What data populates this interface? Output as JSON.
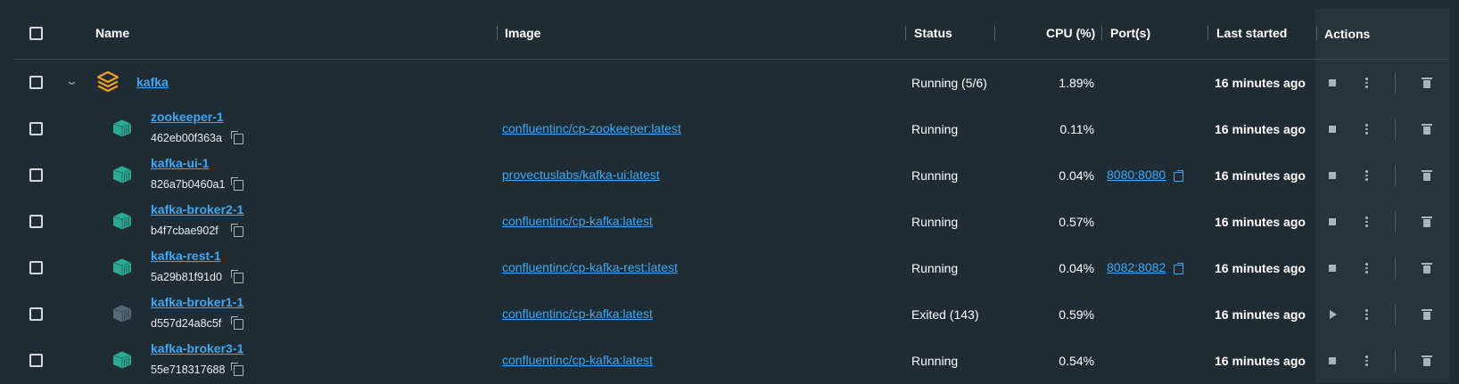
{
  "header": {
    "name": "Name",
    "image": "Image",
    "status": "Status",
    "cpu": "CPU (%)",
    "ports": "Port(s)",
    "last_started": "Last started",
    "actions": "Actions"
  },
  "stack": {
    "name": "kafka",
    "status": "Running (5/6)",
    "cpu": "1.89%",
    "last_started": "16 minutes ago",
    "icon": "stack-layers-icon",
    "icon_color": "#f0a020"
  },
  "containers": [
    {
      "name": "zookeeper-1",
      "id": "462eb00f363a",
      "image": "confluentinc/cp-zookeeper:latest",
      "status": "Running",
      "cpu": "0.11%",
      "port": "",
      "last_started": "16 minutes ago",
      "running": true
    },
    {
      "name": "kafka-ui-1",
      "id": "826a7b0460a1",
      "image": "provectuslabs/kafka-ui:latest",
      "status": "Running",
      "cpu": "0.04%",
      "port": "8080:8080",
      "last_started": "16 minutes ago",
      "running": true
    },
    {
      "name": "kafka-broker2-1",
      "id": "b4f7cbae902f",
      "image": "confluentinc/cp-kafka:latest",
      "status": "Running",
      "cpu": "0.57%",
      "port": "",
      "last_started": "16 minutes ago",
      "running": true
    },
    {
      "name": "kafka-rest-1",
      "id": "5a29b81f91d0",
      "image": "confluentinc/cp-kafka-rest:latest",
      "status": "Running",
      "cpu": "0.04%",
      "port": "8082:8082",
      "last_started": "16 minutes ago",
      "running": true
    },
    {
      "name": "kafka-broker1-1",
      "id": "d557d24a8c5f",
      "image": "confluentinc/cp-kafka:latest",
      "status": "Exited (143)",
      "cpu": "0.59%",
      "port": "",
      "last_started": "16 minutes ago",
      "running": false
    },
    {
      "name": "kafka-broker3-1",
      "id": "55e718317688",
      "image": "confluentinc/cp-kafka:latest",
      "status": "Running",
      "cpu": "0.54%",
      "port": "",
      "last_started": "16 minutes ago",
      "running": true
    }
  ],
  "colors": {
    "background": "#202c33",
    "actions_column": "#27343b",
    "link": "#3fa8f4",
    "container_running": "#2bab94",
    "container_exited": "#546a7b",
    "stack_icon": "#f0a020"
  },
  "icons": {
    "select_all": "checkbox-icon",
    "expand": "chevron-down-icon",
    "container": "container-icon",
    "copy": "copy-icon",
    "external_link": "external-link-icon",
    "stop": "stop-icon",
    "start": "play-icon",
    "more": "kebab-menu-icon",
    "delete": "trash-icon"
  }
}
